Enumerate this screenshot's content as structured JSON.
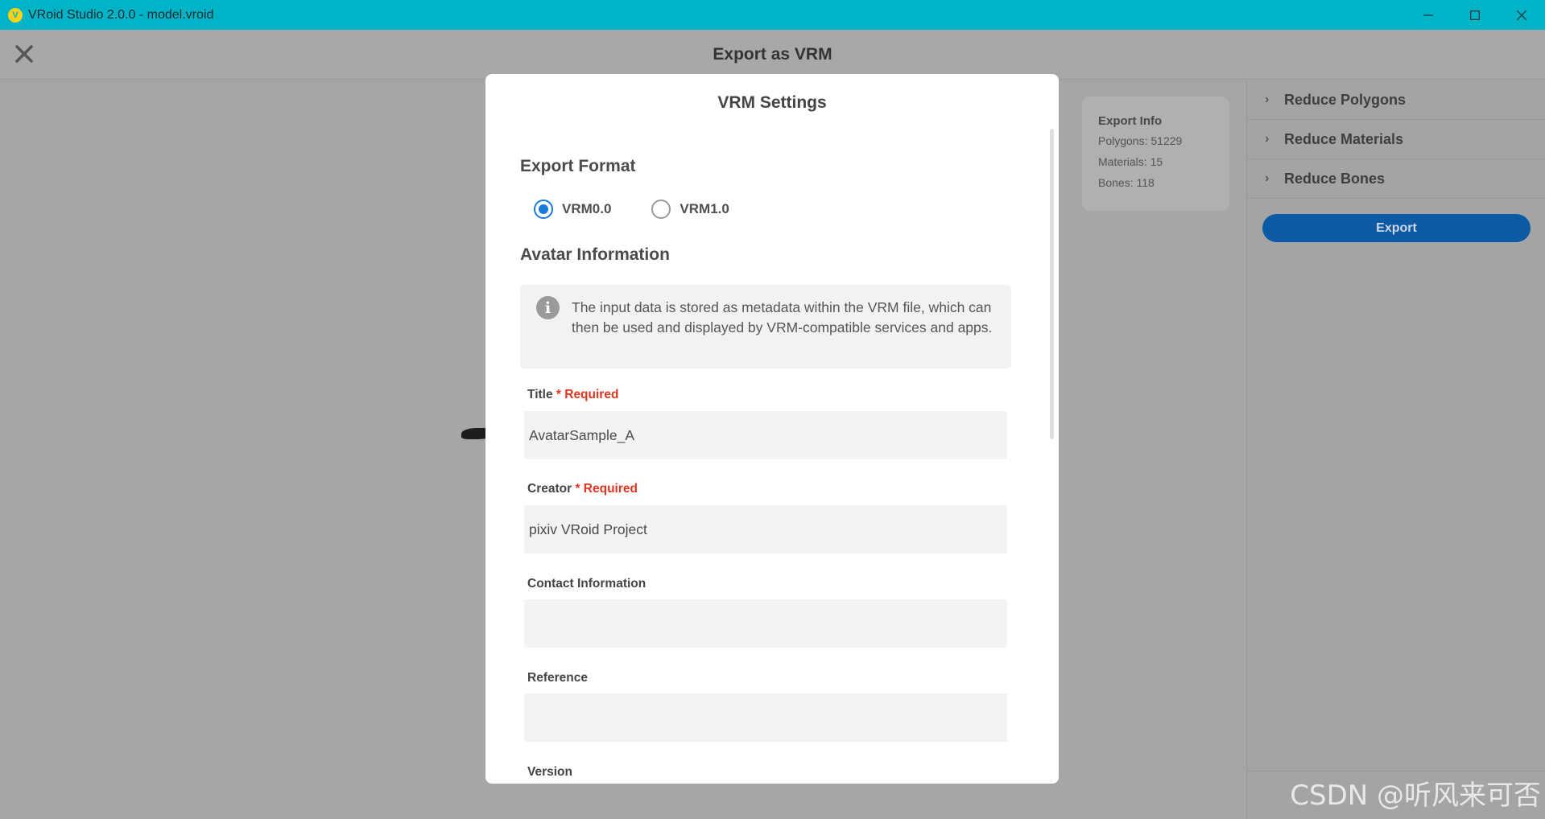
{
  "window": {
    "logo_glyph": "V",
    "title": "VRoid Studio 2.0.0 - model.vroid",
    "controls": [
      "minimize-icon",
      "maximize-icon",
      "close-icon"
    ]
  },
  "header": {
    "title": "Export as VRM"
  },
  "export_info": {
    "title": "Export Info",
    "polygons": "Polygons: 51229",
    "materials": "Materials: 15",
    "bones": "Bones: 118"
  },
  "right_panel": {
    "items": [
      {
        "label": "Reduce Polygons"
      },
      {
        "label": "Reduce Materials"
      },
      {
        "label": "Reduce Bones"
      }
    ],
    "export_label": "Export"
  },
  "modal": {
    "title": "VRM Settings",
    "export_format_heading": "Export Format",
    "formats": [
      {
        "label": "VRM0.0",
        "selected": true
      },
      {
        "label": "VRM1.0",
        "selected": false
      }
    ],
    "avatar_info_heading": "Avatar Information",
    "notice": "The input data is stored as metadata within the VRM file, which can then be used and displayed by VRM-compatible services and apps.",
    "required_mark": "* Required",
    "fields": {
      "title": {
        "label": "Title",
        "value": "AvatarSample_A"
      },
      "creator": {
        "label": "Creator",
        "value": "pixiv VRoid Project"
      },
      "contact": {
        "label": "Contact Information",
        "value": ""
      },
      "reference": {
        "label": "Reference",
        "value": ""
      },
      "version": {
        "label": "Version"
      }
    }
  },
  "watermark": "CSDN @听风来可否",
  "colors": {
    "titlebar": "#00b3c6",
    "accent": "#1a7ad9",
    "export_button": "#0b5aa3",
    "required": "#e0351e"
  }
}
